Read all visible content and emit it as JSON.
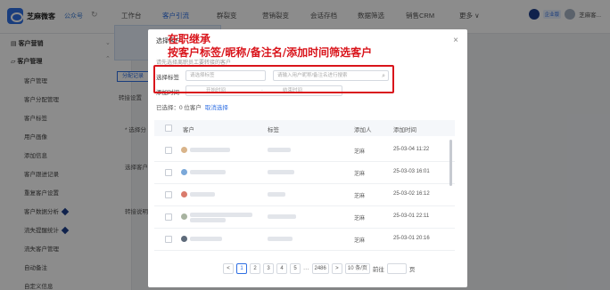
{
  "topnav": {
    "logo_text": "芝麻微客",
    "logo_sub": "公众号",
    "refresh_icon": "↻",
    "tabs": [
      {
        "label": "工作台",
        "active": false
      },
      {
        "label": "客户引流",
        "active": true
      },
      {
        "label": "群裂变",
        "active": false
      },
      {
        "label": "营销裂变",
        "active": false
      },
      {
        "label": "会话存档",
        "active": false
      },
      {
        "label": "数据筛选",
        "active": false
      },
      {
        "label": "销售CRM",
        "active": false
      },
      {
        "label": "更多 ∨",
        "active": false
      }
    ],
    "right_tag": "企业版",
    "right_user": "芝麻客..."
  },
  "sidebar": {
    "groups": [
      {
        "label": "客户营销",
        "icon": "list-icon"
      },
      {
        "label": "客户管理",
        "icon": "folder-icon"
      }
    ],
    "items": [
      {
        "label": "客户管理",
        "gem": false
      },
      {
        "label": "客户分配管理",
        "gem": false
      },
      {
        "label": "客户标签",
        "gem": false
      },
      {
        "label": "用户画像",
        "gem": false
      },
      {
        "label": "添加信息",
        "gem": false
      },
      {
        "label": "客户跟进记录",
        "gem": false
      },
      {
        "label": "重复客户设置",
        "gem": false
      },
      {
        "label": "客户数据分析",
        "gem": true
      },
      {
        "label": "流失提醒统计",
        "gem": true
      },
      {
        "label": "流失客户管理",
        "gem": false
      },
      {
        "label": "自动备注",
        "gem": false
      },
      {
        "label": "自定义信息",
        "gem": false
      }
    ]
  },
  "background": {
    "btn": "分配记录",
    "label1": "转接设置",
    "label2": "* 选择分",
    "label3": "选择客户",
    "label4": "转接说明"
  },
  "modal": {
    "title": "选择客户",
    "close": "×",
    "subtitle": "请先选择离职员工要转接的客户",
    "filter": {
      "label": "选择标签",
      "tag_placeholder": "请选择标签",
      "search_placeholder": "请输入用户昵称/备注名进行搜索",
      "time_label": "添加时间",
      "start_placeholder": "开始时间",
      "dash": "-",
      "end_placeholder": "结束时间"
    },
    "selected_text": "已选择：0 位客户",
    "cancel_select": "取消选择",
    "columns": [
      "客户",
      "标签",
      "添加人",
      "添加时间"
    ],
    "rows": [
      {
        "adder": "芝麻",
        "time": "25-03-04 11:22"
      },
      {
        "adder": "芝麻",
        "time": "25-03-03 16:01"
      },
      {
        "adder": "芝麻",
        "time": "25-03-02 16:12"
      },
      {
        "adder": "芝麻",
        "time": "25-03-01 22:11"
      },
      {
        "adder": "芝麻",
        "time": "25-03-01 20:16"
      }
    ],
    "pagination": {
      "prev": "<",
      "pages": [
        "1",
        "2",
        "3",
        "4",
        "5",
        "···",
        "2486"
      ],
      "current": "1",
      "next": ">",
      "page_size": "10 条/页",
      "goto_label": "前往",
      "goto_suffix": "页"
    }
  },
  "annotation": {
    "line1": "在职继承",
    "line2": "按客户标签/昵称/备注名/添加时间筛选客户"
  }
}
